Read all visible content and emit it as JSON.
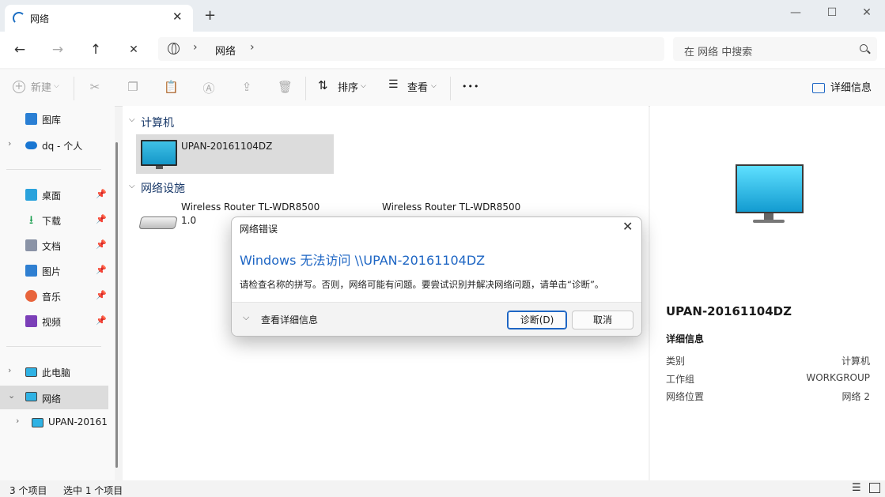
{
  "tab": {
    "title": "网络",
    "close": "✕",
    "new": "+"
  },
  "window": {
    "minimize": "—",
    "maximize": "☐",
    "close": "✕"
  },
  "nav": {
    "back": "←",
    "forward": "→",
    "up": "↑",
    "cancel": "✕"
  },
  "address": {
    "crumb": "网络",
    "sep": "›"
  },
  "search": {
    "placeholder": "在 网络 中搜索"
  },
  "toolbar": {
    "new_label": "新建",
    "sort_label": "排序",
    "view_label": "查看",
    "more": "•••",
    "details_label": "详细信息"
  },
  "sidebar": {
    "items": [
      {
        "label": "图库"
      },
      {
        "label": "dq - 个人"
      },
      {
        "label": "桌面"
      },
      {
        "label": "下载"
      },
      {
        "label": "文档"
      },
      {
        "label": "图片"
      },
      {
        "label": "音乐"
      },
      {
        "label": "视频"
      },
      {
        "label": "此电脑"
      },
      {
        "label": "网络"
      },
      {
        "label": "UPAN-20161"
      }
    ]
  },
  "content": {
    "group_computer": "计算机",
    "group_devices": "网络设施",
    "computer_name": "UPAN-20161104DZ",
    "router1_name": "Wireless Router TL-WDR8500",
    "router1_version": "1.0",
    "router2_name": "Wireless Router TL-WDR8500"
  },
  "details": {
    "title": "UPAN-20161104DZ",
    "subtitle": "详细信息",
    "rows": [
      {
        "key": "类别",
        "value": "计算机"
      },
      {
        "key": "工作组",
        "value": "WORKGROUP"
      },
      {
        "key": "网络位置",
        "value": "网络 2"
      }
    ]
  },
  "status": {
    "count": "3 个项目",
    "selected": "选中 1 个项目"
  },
  "dialog": {
    "title": "网络错误",
    "heading": "Windows 无法访问 \\\\UPAN-20161104DZ",
    "message": "请检查名称的拼写。否则，网络可能有问题。要尝试识别并解决网络问题，请单击“诊断”。",
    "details_toggle": "查看详细信息",
    "diagnose_label": "诊断(D)",
    "cancel_label": "取消"
  },
  "colors": {
    "accent": "#1e66c4",
    "selection": "#dcdcdc"
  }
}
